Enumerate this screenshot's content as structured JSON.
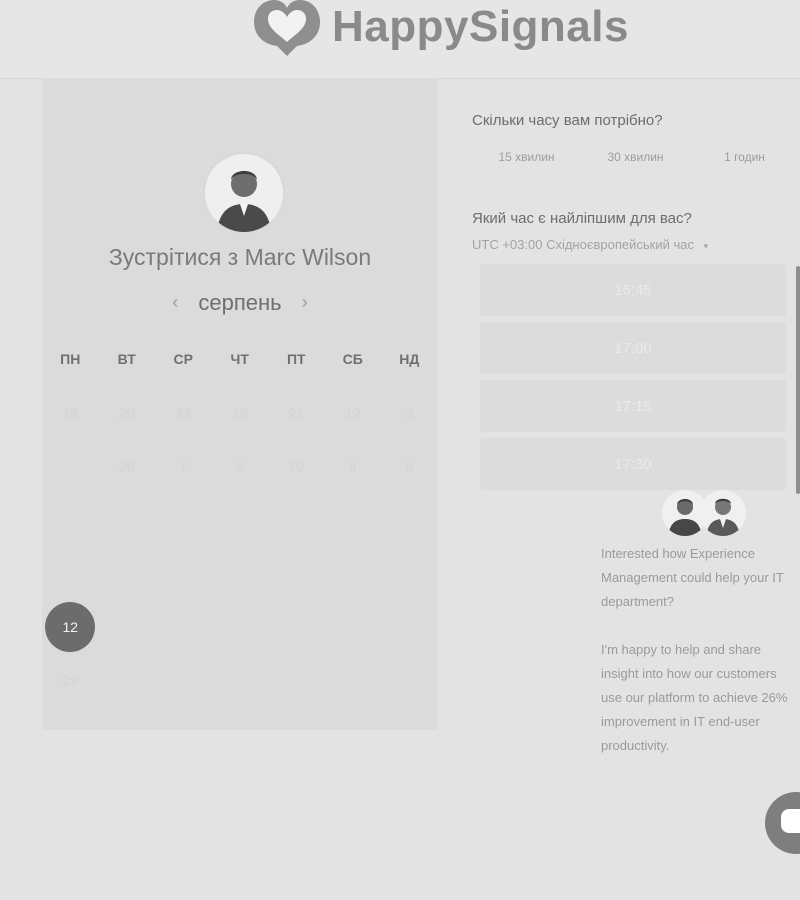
{
  "brand": {
    "name": "HappySignals"
  },
  "calendar": {
    "title": "Зустрітися з Marc Wilson",
    "month": "серпень",
    "prev_icon": "‹",
    "next_icon": "›",
    "weekdays": [
      "ПН",
      "ВТ",
      "СР",
      "ЧТ",
      "ПТ",
      "СБ",
      "НД"
    ],
    "weeks": [
      [
        "19",
        "20",
        "22",
        "19",
        "21",
        "12",
        "3"
      ],
      [
        "",
        "26",
        "7",
        "8",
        "20",
        "8",
        "9"
      ],
      [
        "",
        "",
        "",
        "",
        "",
        "",
        ""
      ],
      [
        "",
        "",
        "",
        "",
        "",
        "",
        ""
      ],
      [
        "12",
        "",
        "",
        "",
        "",
        "",
        ""
      ],
      [
        "29",
        "",
        "",
        "",
        "",
        "",
        ""
      ]
    ],
    "selected_day": "12"
  },
  "scheduler": {
    "duration_question": "Скільки часу вам потрібно?",
    "durations": [
      "15 хвилин",
      "30 хвилин",
      "1 годин"
    ],
    "time_question": "Який час є найліпшим для вас?",
    "timezone": "UTC +03:00 Східноєвропейський час",
    "times": [
      "16:45",
      "17:00",
      "17:15",
      "17:30"
    ]
  },
  "chat": {
    "messages": [
      "Interested how Experience Management could help your IT department?",
      "I'm happy to help and share insight into how our customers use our platform to achieve 26% improvement in IT end-user productivity."
    ]
  },
  "colors": {
    "selected": "#6c6c6c",
    "panel": "#dbdbdb",
    "background": "#e3e3e3"
  }
}
